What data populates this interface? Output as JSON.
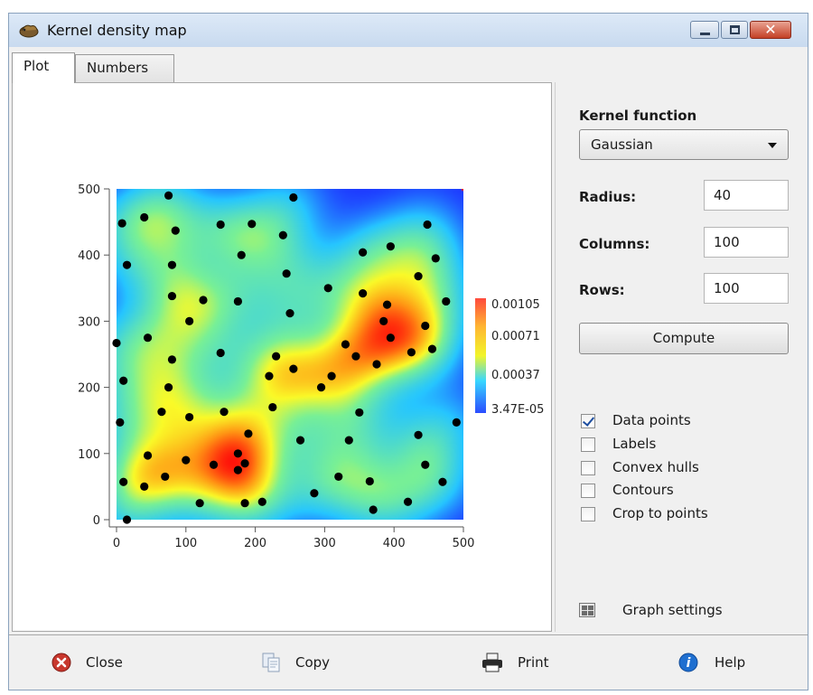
{
  "window": {
    "title": "Kernel density map"
  },
  "tabs": [
    {
      "label": "Plot",
      "active": true
    },
    {
      "label": "Numbers",
      "active": false
    }
  ],
  "plot": {
    "x_ticks": [
      "0",
      "100",
      "200",
      "300",
      "400",
      "500"
    ],
    "y_ticks": [
      "0",
      "100",
      "200",
      "300",
      "400",
      "500"
    ],
    "colorbar_labels": [
      "0.00105",
      "0.00071",
      "0.00037",
      "3.47E-05"
    ],
    "colormap": [
      "#1e3cff",
      "#26c6ff",
      "#ffff22",
      "#ff8800",
      "#ff0000"
    ]
  },
  "chart_data": {
    "type": "scatter",
    "title": "",
    "xlabel": "",
    "ylabel": "",
    "xlim": [
      0,
      500
    ],
    "ylim": [
      0,
      500
    ],
    "points": [
      [
        75,
        490
      ],
      [
        255,
        487
      ],
      [
        8,
        448
      ],
      [
        40,
        457
      ],
      [
        85,
        437
      ],
      [
        150,
        446
      ],
      [
        195,
        447
      ],
      [
        240,
        430
      ],
      [
        448,
        446
      ],
      [
        15,
        385
      ],
      [
        80,
        385
      ],
      [
        180,
        400
      ],
      [
        355,
        404
      ],
      [
        395,
        413
      ],
      [
        460,
        395
      ],
      [
        245,
        372
      ],
      [
        305,
        350
      ],
      [
        435,
        368
      ],
      [
        80,
        338
      ],
      [
        125,
        332
      ],
      [
        175,
        330
      ],
      [
        250,
        312
      ],
      [
        355,
        342
      ],
      [
        475,
        330
      ],
      [
        390,
        325
      ],
      [
        105,
        300
      ],
      [
        385,
        300
      ],
      [
        445,
        293
      ],
      [
        0,
        267
      ],
      [
        45,
        275
      ],
      [
        150,
        252
      ],
      [
        230,
        247
      ],
      [
        330,
        265
      ],
      [
        345,
        247
      ],
      [
        395,
        275
      ],
      [
        425,
        253
      ],
      [
        455,
        258
      ],
      [
        80,
        242
      ],
      [
        220,
        217
      ],
      [
        255,
        228
      ],
      [
        310,
        217
      ],
      [
        295,
        200
      ],
      [
        375,
        235
      ],
      [
        10,
        210
      ],
      [
        75,
        200
      ],
      [
        65,
        163
      ],
      [
        105,
        155
      ],
      [
        155,
        163
      ],
      [
        225,
        170
      ],
      [
        350,
        162
      ],
      [
        5,
        147
      ],
      [
        490,
        147
      ],
      [
        435,
        128
      ],
      [
        190,
        130
      ],
      [
        265,
        120
      ],
      [
        335,
        120
      ],
      [
        45,
        97
      ],
      [
        175,
        100
      ],
      [
        100,
        90
      ],
      [
        185,
        85
      ],
      [
        140,
        83
      ],
      [
        175,
        75
      ],
      [
        445,
        83
      ],
      [
        10,
        57
      ],
      [
        70,
        65
      ],
      [
        40,
        50
      ],
      [
        470,
        57
      ],
      [
        320,
        65
      ],
      [
        365,
        58
      ],
      [
        120,
        25
      ],
      [
        185,
        25
      ],
      [
        210,
        27
      ],
      [
        285,
        40
      ],
      [
        370,
        15
      ],
      [
        420,
        27
      ],
      [
        15,
        0
      ]
    ],
    "density_peaks": [
      {
        "x": 170,
        "y": 90,
        "value": 0.00105
      },
      {
        "x": 400,
        "y": 290,
        "value": 0.00095
      }
    ],
    "colorbar": {
      "min": 3.47e-05,
      "max": 0.00105,
      "labels": [
        "0.00105",
        "0.00071",
        "0.00037",
        "3.47E-05"
      ]
    },
    "grid": false,
    "legend": "right"
  },
  "controls": {
    "kernel_function_label": "Kernel function",
    "kernel_function_value": "Gaussian",
    "radius_label": "Radius:",
    "radius_value": "40",
    "columns_label": "Columns:",
    "columns_value": "100",
    "rows_label": "Rows:",
    "rows_value": "100",
    "compute_label": "Compute",
    "checkboxes": [
      {
        "label": "Data points",
        "checked": true
      },
      {
        "label": "Labels",
        "checked": false
      },
      {
        "label": "Convex hulls",
        "checked": false
      },
      {
        "label": "Contours",
        "checked": false
      },
      {
        "label": "Crop to points",
        "checked": false
      }
    ],
    "graph_settings_label": "Graph settings"
  },
  "bottom_bar": {
    "close_label": "Close",
    "copy_label": "Copy",
    "print_label": "Print",
    "help_label": "Help"
  },
  "icons": {
    "app": "app-icon",
    "close": "close-icon",
    "copy": "copy-icon",
    "print": "print-icon",
    "help": "help-icon",
    "graph_settings": "grid-icon"
  }
}
